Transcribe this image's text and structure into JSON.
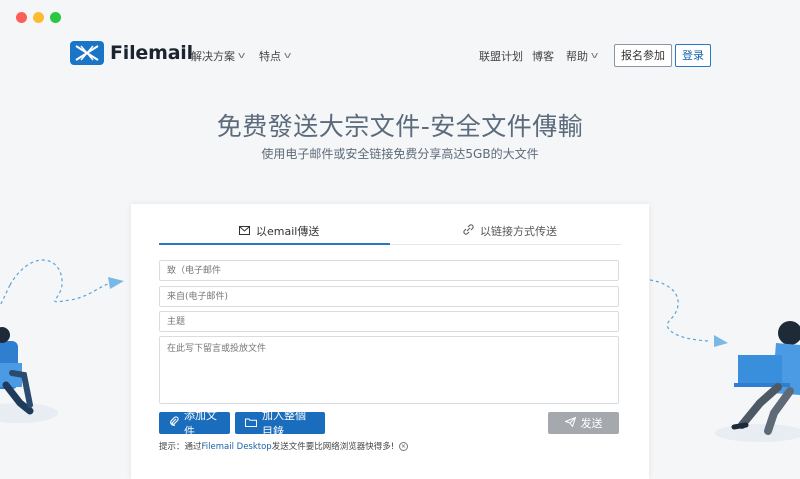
{
  "header": {
    "brand": "Filemail",
    "nav_left": [
      {
        "label": "解决方案"
      },
      {
        "label": "特点"
      }
    ],
    "nav_right": {
      "affiliate": "联盟计划",
      "blog": "博客",
      "help": "帮助",
      "signup": "报名参加",
      "login": "登录"
    }
  },
  "hero": {
    "title": "免费發送大宗文件-安全文件傳輸",
    "subtitle": "使用电子邮件或安全链接免费分享高达5GB的大文件"
  },
  "form": {
    "tabs": [
      {
        "label": "以email傳送",
        "icon": "envelope-icon",
        "active": true
      },
      {
        "label": "以链接方式传送",
        "icon": "link-icon",
        "active": false
      }
    ],
    "fields": {
      "to_placeholder": "致（电子邮件",
      "from_placeholder": "来自(电子邮件)",
      "subject_placeholder": "主题",
      "message_placeholder": "在此写下留言或投放文件"
    },
    "buttons": {
      "add_files": "添加文件",
      "add_folder": "加入整個目錄",
      "send": "发送"
    },
    "tip": {
      "prefix": "提示：通过",
      "link": "Filemail Desktop",
      "suffix": "发送文件要比网络浏览器快得多!"
    }
  },
  "colors": {
    "brand_blue": "#1a6cbc",
    "send_disabled": "#a5a9ad",
    "page_bg": "#f5f6f8"
  }
}
